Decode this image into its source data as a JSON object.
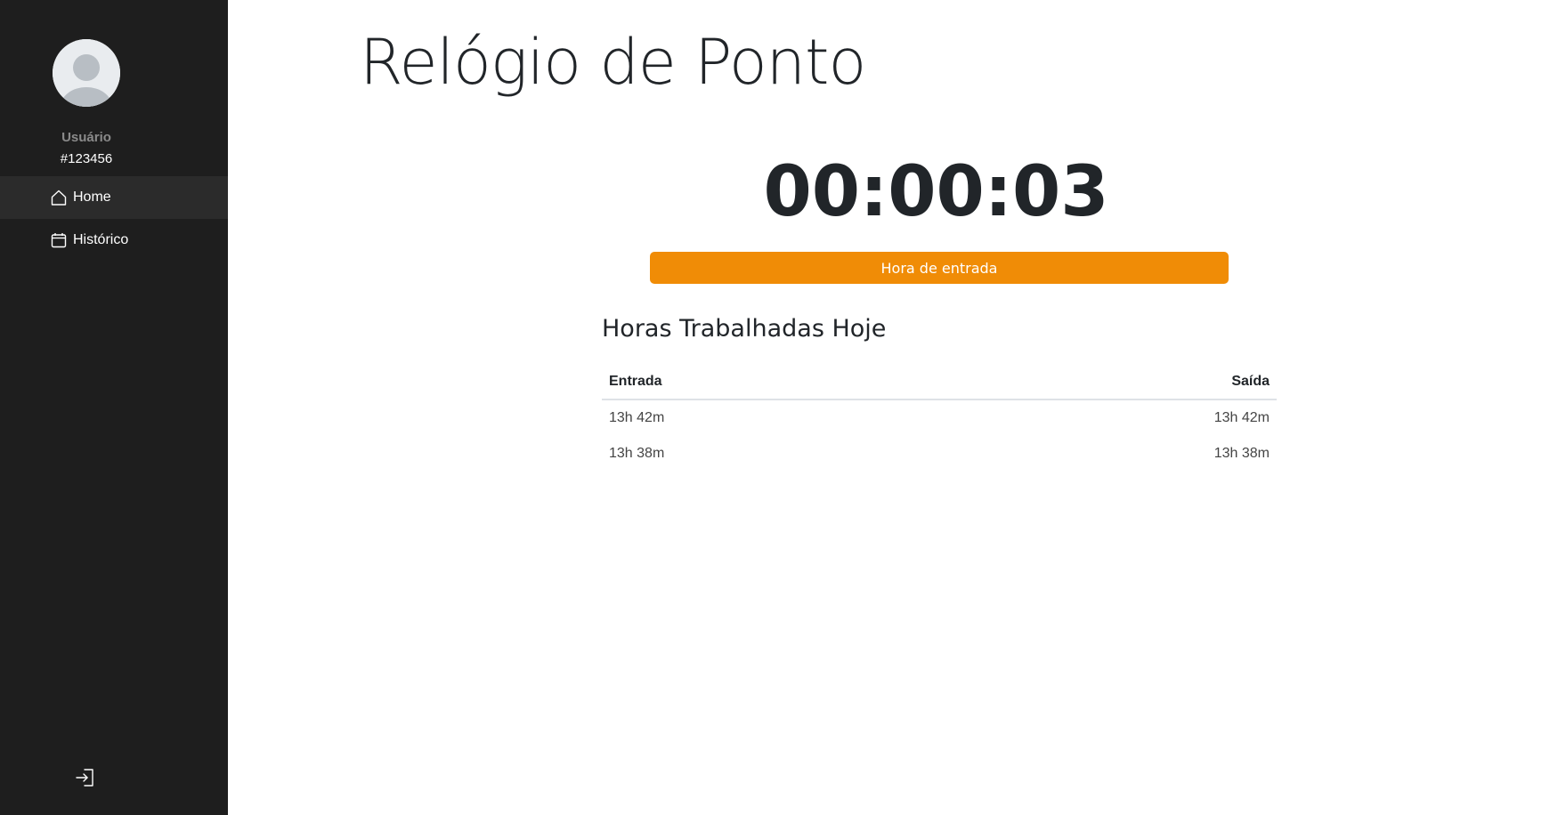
{
  "sidebar": {
    "user_label": "Usuário",
    "user_id": "#123456",
    "nav": [
      {
        "label": "Home",
        "icon": "home-icon",
        "active": true
      },
      {
        "label": "Histórico",
        "icon": "calendar-icon",
        "active": false
      }
    ],
    "logout_icon": "logout-icon",
    "background": "#1e1e1e"
  },
  "main": {
    "title": "Relógio de Ponto",
    "timer": "00:00:03",
    "clock_button": {
      "label": "Hora de entrada",
      "color": "#f08c06"
    },
    "hours_section": {
      "title": "Horas Trabalhadas Hoje",
      "columns": [
        "Entrada",
        "Saída"
      ],
      "rows": [
        [
          "13h 42m",
          "13h 42m"
        ],
        [
          "13h 38m",
          "13h 38m"
        ]
      ]
    }
  }
}
